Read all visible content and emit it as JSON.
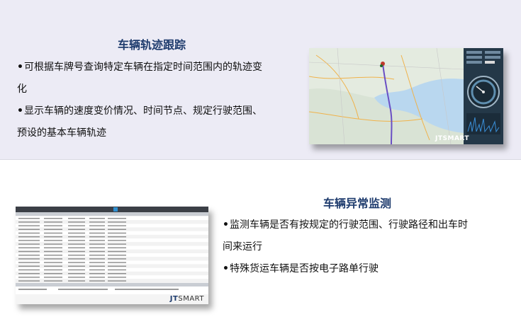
{
  "section1": {
    "title": "车辆轨迹跟踪",
    "bullets": [
      [
        "可根据车牌号查询特定车辆在指定时间范围内的轨迹变",
        "化"
      ],
      [
        "显示车辆的速度变价情况、时间节点、规定行驶范围、",
        "预设的基本车辆轨迹"
      ]
    ],
    "screenshot": {
      "brand_prefix": "JT",
      "brand_suffix": "SMART"
    }
  },
  "section2": {
    "title": "车辆异常监测",
    "bullets": [
      [
        "监测车辆是否有按规定的行驶范围、行驶路径和出车时",
        "间来运行"
      ],
      [
        "特殊货运车辆是否按电子路单行驶"
      ]
    ],
    "screenshot": {
      "brand_prefix": "JT",
      "brand_suffix": "SMART"
    }
  },
  "colors": {
    "title": "#1f3c6e",
    "panel_bg": "#ecebf5",
    "route": "#6a4fc4",
    "dashboard": "#243848"
  }
}
